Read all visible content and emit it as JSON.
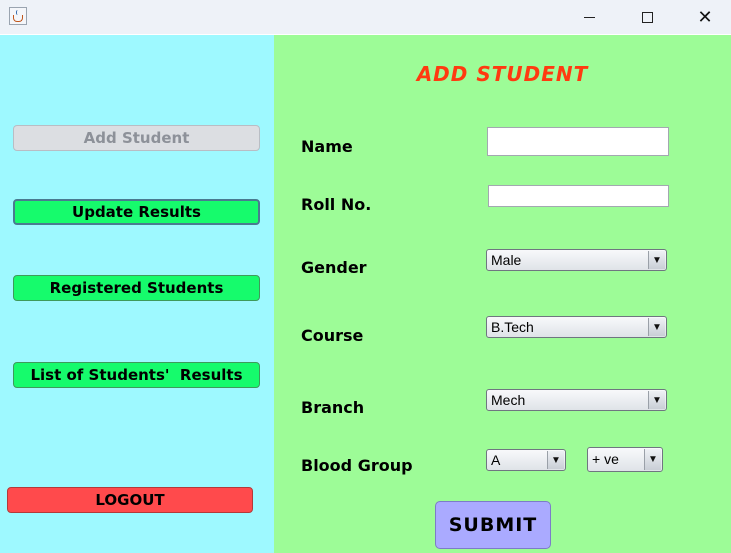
{
  "window": {
    "minimize_glyph": "",
    "maximize_glyph": "",
    "close_glyph": "✕"
  },
  "sidebar": {
    "add_student": "Add Student",
    "update_results": "Update Results",
    "registered_students": "Registered Students",
    "list_results": "List of Students'  Results",
    "logout": "LOGOUT"
  },
  "form": {
    "title": "ADD STUDENT",
    "name_label": "Name",
    "name_value": "",
    "roll_label": "Roll No.",
    "roll_value": "",
    "gender_label": "Gender",
    "gender_value": "Male",
    "course_label": "Course",
    "course_value": "B.Tech",
    "branch_label": "Branch",
    "branch_value": "Mech",
    "blood_label": "Blood Group",
    "blood_group_value": "A",
    "rh_value": "+ ve",
    "submit": "SUBMIT"
  },
  "colors": {
    "sidebar_bg": "#9ef9ff",
    "main_bg": "#9dfc97",
    "button_green": "#16fb6c",
    "logout_red": "#ff4a4c",
    "title_red": "#ff3a10",
    "submit_bg": "#aaaaff"
  }
}
